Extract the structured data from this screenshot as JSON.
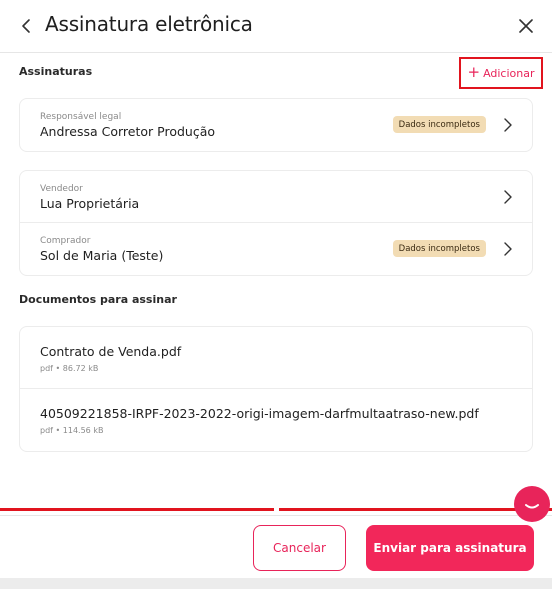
{
  "header": {
    "title": "Assinatura eletrônica"
  },
  "signatures": {
    "label": "Assinaturas",
    "add_label": "Adicionar",
    "groups": [
      [
        {
          "role": "Responsável legal",
          "name": "Andressa Corretor Produção",
          "badge": "Dados incompletos"
        }
      ],
      [
        {
          "role": "Vendedor",
          "name": "Lua Proprietária",
          "badge": ""
        },
        {
          "role": "Comprador",
          "name": "Sol de Maria (Teste)",
          "badge": "Dados incompletos"
        }
      ]
    ]
  },
  "documents": {
    "label": "Documentos para assinar",
    "items": [
      {
        "name": "Contrato de Venda.pdf",
        "meta": "pdf • 86.72 kB"
      },
      {
        "name": "40509221858-IRPF-2023-2022-origi-imagem-darfmultaatraso-new.pdf",
        "meta": "pdf • 114.56 kB"
      }
    ]
  },
  "footer": {
    "cancel_label": "Cancelar",
    "send_label": "Enviar para assinatura"
  },
  "colors": {
    "accent": "#f2275a",
    "highlight_border": "#e1141e",
    "badge_bg": "#f2dcb4"
  }
}
